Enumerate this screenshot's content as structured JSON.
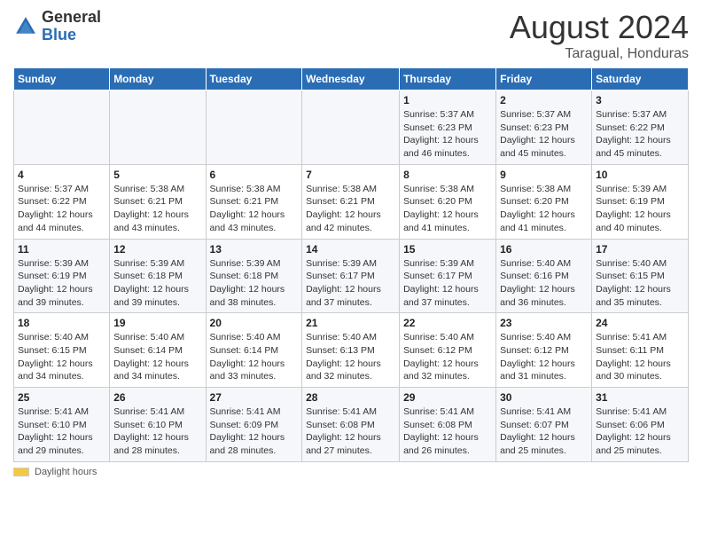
{
  "logo": {
    "general": "General",
    "blue": "Blue",
    "icon_color": "#2a6db5"
  },
  "header": {
    "title": "August 2024",
    "subtitle": "Taragual, Honduras"
  },
  "weekdays": [
    "Sunday",
    "Monday",
    "Tuesday",
    "Wednesday",
    "Thursday",
    "Friday",
    "Saturday"
  ],
  "weeks": [
    [
      {
        "day": "",
        "info": ""
      },
      {
        "day": "",
        "info": ""
      },
      {
        "day": "",
        "info": ""
      },
      {
        "day": "",
        "info": ""
      },
      {
        "day": "1",
        "info": "Sunrise: 5:37 AM\nSunset: 6:23 PM\nDaylight: 12 hours\nand 46 minutes."
      },
      {
        "day": "2",
        "info": "Sunrise: 5:37 AM\nSunset: 6:23 PM\nDaylight: 12 hours\nand 45 minutes."
      },
      {
        "day": "3",
        "info": "Sunrise: 5:37 AM\nSunset: 6:22 PM\nDaylight: 12 hours\nand 45 minutes."
      }
    ],
    [
      {
        "day": "4",
        "info": "Sunrise: 5:37 AM\nSunset: 6:22 PM\nDaylight: 12 hours\nand 44 minutes."
      },
      {
        "day": "5",
        "info": "Sunrise: 5:38 AM\nSunset: 6:21 PM\nDaylight: 12 hours\nand 43 minutes."
      },
      {
        "day": "6",
        "info": "Sunrise: 5:38 AM\nSunset: 6:21 PM\nDaylight: 12 hours\nand 43 minutes."
      },
      {
        "day": "7",
        "info": "Sunrise: 5:38 AM\nSunset: 6:21 PM\nDaylight: 12 hours\nand 42 minutes."
      },
      {
        "day": "8",
        "info": "Sunrise: 5:38 AM\nSunset: 6:20 PM\nDaylight: 12 hours\nand 41 minutes."
      },
      {
        "day": "9",
        "info": "Sunrise: 5:38 AM\nSunset: 6:20 PM\nDaylight: 12 hours\nand 41 minutes."
      },
      {
        "day": "10",
        "info": "Sunrise: 5:39 AM\nSunset: 6:19 PM\nDaylight: 12 hours\nand 40 minutes."
      }
    ],
    [
      {
        "day": "11",
        "info": "Sunrise: 5:39 AM\nSunset: 6:19 PM\nDaylight: 12 hours\nand 39 minutes."
      },
      {
        "day": "12",
        "info": "Sunrise: 5:39 AM\nSunset: 6:18 PM\nDaylight: 12 hours\nand 39 minutes."
      },
      {
        "day": "13",
        "info": "Sunrise: 5:39 AM\nSunset: 6:18 PM\nDaylight: 12 hours\nand 38 minutes."
      },
      {
        "day": "14",
        "info": "Sunrise: 5:39 AM\nSunset: 6:17 PM\nDaylight: 12 hours\nand 37 minutes."
      },
      {
        "day": "15",
        "info": "Sunrise: 5:39 AM\nSunset: 6:17 PM\nDaylight: 12 hours\nand 37 minutes."
      },
      {
        "day": "16",
        "info": "Sunrise: 5:40 AM\nSunset: 6:16 PM\nDaylight: 12 hours\nand 36 minutes."
      },
      {
        "day": "17",
        "info": "Sunrise: 5:40 AM\nSunset: 6:15 PM\nDaylight: 12 hours\nand 35 minutes."
      }
    ],
    [
      {
        "day": "18",
        "info": "Sunrise: 5:40 AM\nSunset: 6:15 PM\nDaylight: 12 hours\nand 34 minutes."
      },
      {
        "day": "19",
        "info": "Sunrise: 5:40 AM\nSunset: 6:14 PM\nDaylight: 12 hours\nand 34 minutes."
      },
      {
        "day": "20",
        "info": "Sunrise: 5:40 AM\nSunset: 6:14 PM\nDaylight: 12 hours\nand 33 minutes."
      },
      {
        "day": "21",
        "info": "Sunrise: 5:40 AM\nSunset: 6:13 PM\nDaylight: 12 hours\nand 32 minutes."
      },
      {
        "day": "22",
        "info": "Sunrise: 5:40 AM\nSunset: 6:12 PM\nDaylight: 12 hours\nand 32 minutes."
      },
      {
        "day": "23",
        "info": "Sunrise: 5:40 AM\nSunset: 6:12 PM\nDaylight: 12 hours\nand 31 minutes."
      },
      {
        "day": "24",
        "info": "Sunrise: 5:41 AM\nSunset: 6:11 PM\nDaylight: 12 hours\nand 30 minutes."
      }
    ],
    [
      {
        "day": "25",
        "info": "Sunrise: 5:41 AM\nSunset: 6:10 PM\nDaylight: 12 hours\nand 29 minutes."
      },
      {
        "day": "26",
        "info": "Sunrise: 5:41 AM\nSunset: 6:10 PM\nDaylight: 12 hours\nand 28 minutes."
      },
      {
        "day": "27",
        "info": "Sunrise: 5:41 AM\nSunset: 6:09 PM\nDaylight: 12 hours\nand 28 minutes."
      },
      {
        "day": "28",
        "info": "Sunrise: 5:41 AM\nSunset: 6:08 PM\nDaylight: 12 hours\nand 27 minutes."
      },
      {
        "day": "29",
        "info": "Sunrise: 5:41 AM\nSunset: 6:08 PM\nDaylight: 12 hours\nand 26 minutes."
      },
      {
        "day": "30",
        "info": "Sunrise: 5:41 AM\nSunset: 6:07 PM\nDaylight: 12 hours\nand 25 minutes."
      },
      {
        "day": "31",
        "info": "Sunrise: 5:41 AM\nSunset: 6:06 PM\nDaylight: 12 hours\nand 25 minutes."
      }
    ]
  ],
  "footer": {
    "daylight_label": "Daylight hours"
  }
}
